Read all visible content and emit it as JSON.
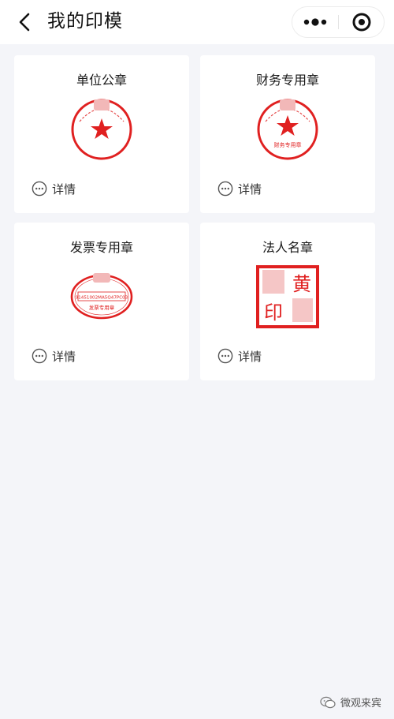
{
  "nav": {
    "title": "我的印模"
  },
  "cards": [
    {
      "title": "单位公章",
      "detail_label": "详情",
      "stamp_subtext": ""
    },
    {
      "title": "财务专用章",
      "detail_label": "详情",
      "stamp_subtext": "财务专用章"
    },
    {
      "title": "发票专用章",
      "detail_label": "详情",
      "stamp_number": "91451002MA5Q47PC03",
      "stamp_subtext": "发票专用章"
    },
    {
      "title": "法人名章",
      "detail_label": "详情",
      "stamp_chars": [
        "黄",
        "印"
      ]
    }
  ],
  "watermark": {
    "text": "微观来宾"
  },
  "colors": {
    "stamp_red": "#e02020",
    "background": "#f4f5f9",
    "card": "#ffffff"
  }
}
